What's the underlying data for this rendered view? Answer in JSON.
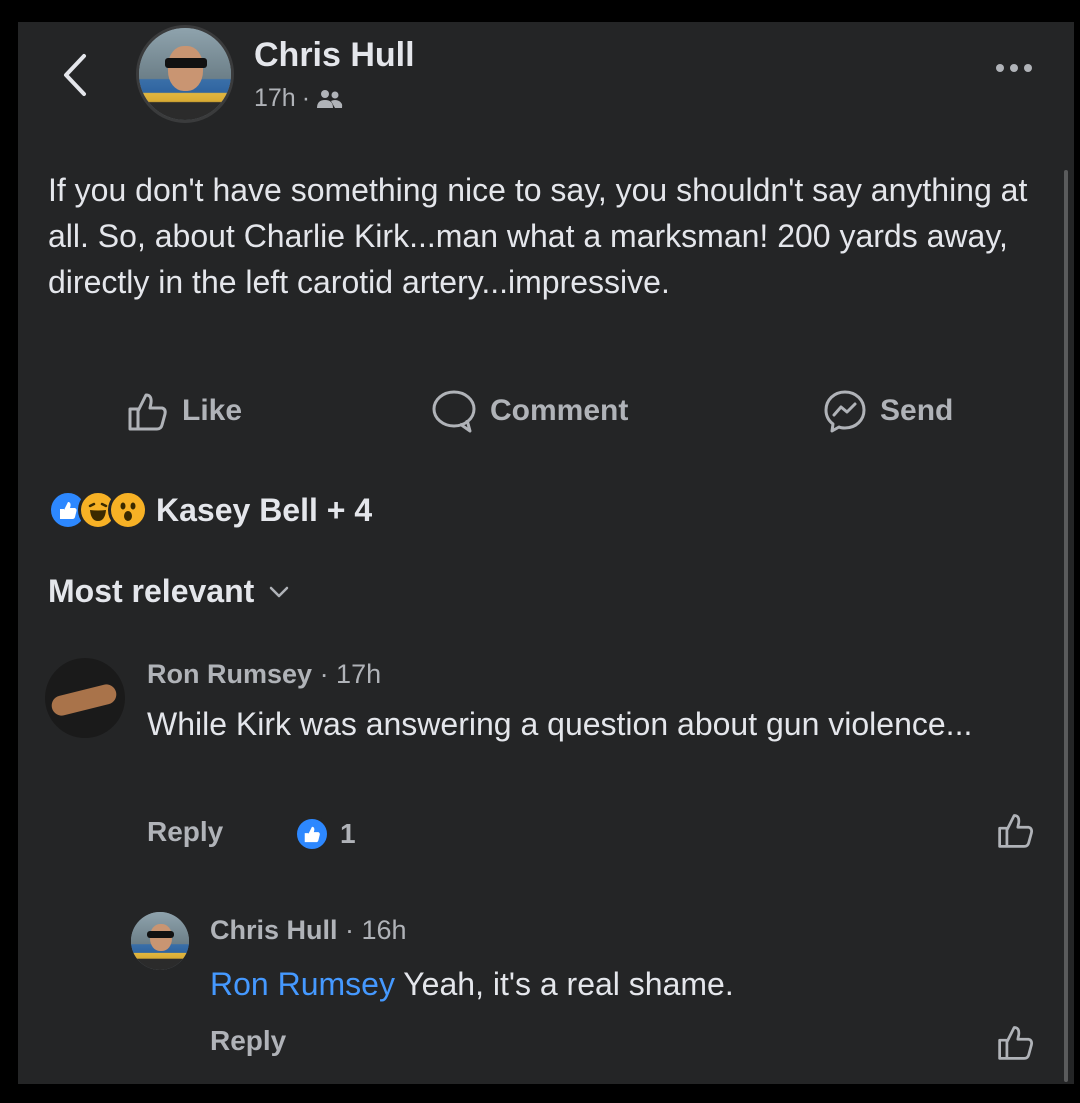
{
  "post": {
    "author": "Chris Hull",
    "time": "17h",
    "separator": "·",
    "audience_icon": "friends-icon",
    "text": "If you don't have something nice to say, you shouldn't say anything at all. So, about Charlie Kirk...man what a marksman! 200 yards away, directly in the left carotid artery...impressive."
  },
  "actions": {
    "like": "Like",
    "comment": "Comment",
    "send": "Send"
  },
  "reactions": {
    "icons": [
      "like-reaction-icon",
      "haha-reaction-icon",
      "wow-reaction-icon"
    ],
    "names": "Kasey Bell + 4"
  },
  "sort_label": "Most relevant",
  "comments": [
    {
      "author": "Ron Rumsey",
      "time": "· 17h",
      "text": "While Kirk was answering a question about gun violence...",
      "reply": "Reply",
      "likes": "1"
    }
  ],
  "reply_comment": {
    "author": "Chris Hull",
    "time": "· 16h",
    "mention": "Ron Rumsey",
    "text": " Yeah, it's a real shame.",
    "reply": "Reply"
  },
  "colors": {
    "background": "#242526",
    "text": "#e4e6eb",
    "secondary": "#b0b3b8",
    "link": "#4599ff",
    "like_blue": "#2d88ff"
  }
}
